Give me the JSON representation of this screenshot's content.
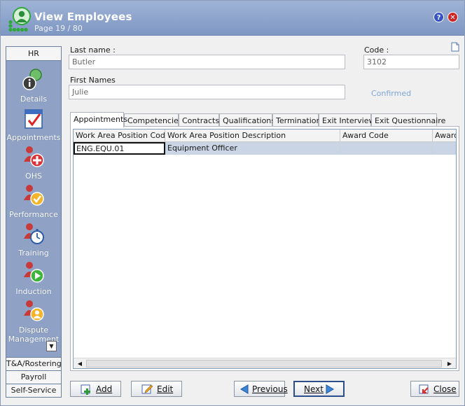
{
  "window": {
    "title": "View Employees",
    "subtitle": "Page 19 / 80",
    "help_label": "?",
    "close_label": "✕"
  },
  "sidebar": {
    "top_tab": "HR",
    "items": [
      {
        "label": "Details",
        "icon": "person-info-icon"
      },
      {
        "label": "Appointments",
        "icon": "calendar-check-icon"
      },
      {
        "label": "OHS",
        "icon": "person-plus-icon"
      },
      {
        "label": "Performance",
        "icon": "person-check-icon"
      },
      {
        "label": "Training",
        "icon": "person-stopwatch-icon"
      },
      {
        "label": "Induction",
        "icon": "person-play-icon"
      },
      {
        "label": "Dispute Management",
        "icon": "person-dispute-icon"
      }
    ],
    "footer_tabs": [
      "T&A/Rostering",
      "Payroll",
      "Self-Service"
    ]
  },
  "form": {
    "last_name_label": "Last name :",
    "last_name_value": "Butler",
    "first_names_label": "First Names",
    "first_names_value": "Julie",
    "code_label": "Code :",
    "code_value": "3102",
    "status": "Confirmed"
  },
  "tabs": [
    "Appointments",
    "Competencies",
    "Contracts",
    "Qualifications",
    "Termination",
    "Exit Interview",
    "Exit Questionnaire"
  ],
  "grid": {
    "columns": [
      "Work Area Position Code",
      "Work Area Position Description",
      "Award Code",
      "Award"
    ],
    "rows": [
      [
        "ENG.EQU.01",
        "Equipment Officer",
        "",
        ""
      ]
    ]
  },
  "buttons": {
    "add": "Add",
    "edit": "Edit",
    "previous": "Previous",
    "next": "Next",
    "close": "Close"
  },
  "colors": {
    "titlebar": "#8da3cc",
    "sidebar": "#8fa2c5",
    "selected_row": "#c9d4e4",
    "confirmed": "#7ea7d6",
    "person_red": "#c83a3a"
  }
}
